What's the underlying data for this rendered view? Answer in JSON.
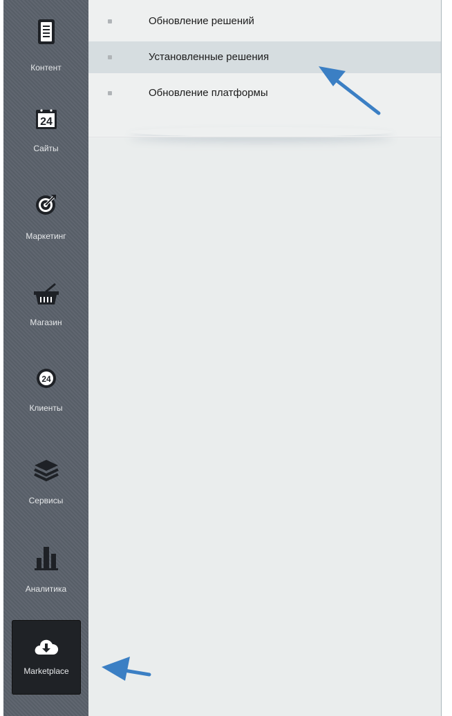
{
  "sidebar": {
    "items": [
      {
        "label": "Контент",
        "icon": "document-icon"
      },
      {
        "label": "Сайты",
        "icon": "calendar-24-icon",
        "icon_text": "24"
      },
      {
        "label": "Маркетинг",
        "icon": "target-icon"
      },
      {
        "label": "Магазин",
        "icon": "basket-icon"
      },
      {
        "label": "Клиенты",
        "icon": "cloud-24-icon",
        "icon_text": "24"
      },
      {
        "label": "Сервисы",
        "icon": "layers-icon"
      },
      {
        "label": "Аналитика",
        "icon": "bar-chart-icon"
      },
      {
        "label": "Marketplace",
        "icon": "cloud-download-icon",
        "active": true
      }
    ]
  },
  "submenu": {
    "items": [
      {
        "label": "Обновление решений"
      },
      {
        "label": "Установленные решения",
        "selected": true
      },
      {
        "label": "Обновление платформы"
      }
    ]
  },
  "colors": {
    "sidebar_bg": "#5a616b",
    "sidebar_active_bg": "#1f2226",
    "main_bg": "#eaeded",
    "selected_row_bg": "#d6dde0",
    "annotation_arrow": "#3b7fc4"
  }
}
